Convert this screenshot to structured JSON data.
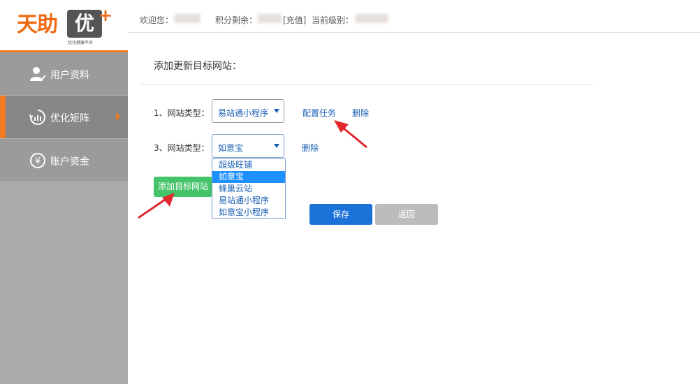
{
  "brand": {
    "logo_main": "天助",
    "logo_box": "优",
    "logo_plus": "+",
    "logo_sub": "优化健康平台"
  },
  "sidebar": {
    "items": [
      {
        "label": "用户资料",
        "icon": "user-icon"
      },
      {
        "label": "优化矩阵",
        "icon": "sync-icon",
        "active": true
      },
      {
        "label": "账户资金",
        "icon": "yen-icon"
      }
    ]
  },
  "topbar": {
    "welcome_label": "欢迎您：",
    "points_label": "积分剩余：",
    "recharge_label": "[充值]",
    "level_label": "当前级别："
  },
  "form": {
    "section_title": "添加更新目标网站：",
    "rows": [
      {
        "label": "1、网站类型：",
        "selected": "易站通小程序",
        "config_link": "配置任务",
        "delete_link": "删除"
      },
      {
        "label": "3、网站类型：",
        "selected": "如意宝",
        "delete_link": "删除"
      }
    ],
    "dropdown_options": [
      "超级旺铺",
      "如意宝",
      "蜂巢云站",
      "易站通小程序",
      "如意宝小程序"
    ],
    "dropdown_selected_index": 1,
    "add_button": "添加目标网站",
    "save_button": "保存",
    "back_button": "返回"
  },
  "colors": {
    "accent_orange": "#f07a22",
    "link_blue": "#1a5fb4",
    "save_blue": "#1a72d8",
    "add_green": "#45c36b",
    "arrow_red": "#e0282e"
  }
}
